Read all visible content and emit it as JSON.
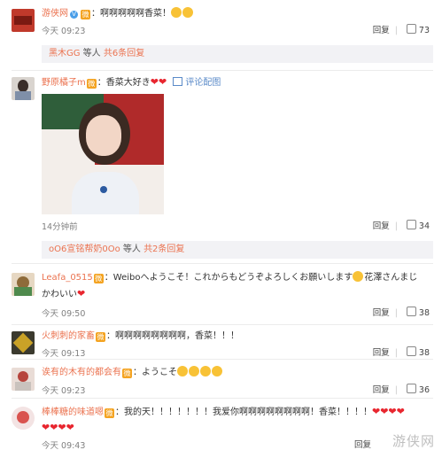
{
  "comments": [
    {
      "username": "游侠网",
      "text": "：啊啊啊啊啊香菜！",
      "time": "今天 09:23",
      "reply_label": "回复",
      "likes": "73",
      "sub_reply": {
        "users": "黑木GG",
        "suffix": " 等人 ",
        "count": "共6条回复"
      }
    },
    {
      "username": "野原橘子m",
      "text": "：香菜大好き",
      "extra": "评论配图",
      "time": "14分钟前",
      "reply_label": "回复",
      "likes": "34",
      "sub_reply": {
        "users": "oO6宣铭帮奶0Oo",
        "suffix": " 等人 ",
        "count": "共2条回复"
      }
    },
    {
      "username": "Leafa_0515",
      "text": "：Weiboへようこそ！これからもどうぞよろしくお願いします",
      "text_cont1": "花澤さんまじ",
      "text_cont2": "かわいい",
      "time": "今天 09:50",
      "reply_label": "回复",
      "likes": "38"
    },
    {
      "username": "火刺刺的家畜",
      "text": "：啊啊啊啊啊啊啊啊，香菜！！！",
      "time": "今天 09:13",
      "reply_label": "回复",
      "likes": "38"
    },
    {
      "username": "诶有的木有的都会有",
      "text": "：ようこそ",
      "time": "今天 09:23",
      "reply_label": "回复",
      "likes": "36"
    },
    {
      "username": "棒棒糖的味道嗯",
      "text": "：我的天！！！！！！！我爱你啊啊啊啊啊啊啊啊！香菜！！！！",
      "time": "今天 09:43",
      "reply_label": "回复",
      "likes": "22"
    }
  ],
  "watermark": "游侠网",
  "colors": {
    "username": "#eb7350",
    "meta": "#808080",
    "heart": "#e8262f",
    "reply_bg": "#f2f2f5"
  }
}
